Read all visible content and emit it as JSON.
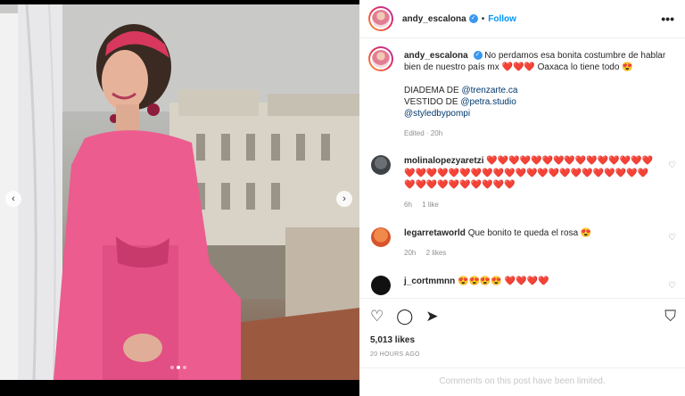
{
  "post": {
    "username": "andy_escalona",
    "follow_label": "Follow",
    "separator": "•",
    "more_glyph": "•••",
    "verified_glyph": "✓"
  },
  "caption": {
    "username": "andy_escalona",
    "text_1": "No perdamos esa bonita costumbre de hablar bien de nuestro país mx",
    "hearts_1": "❤️❤️❤️",
    "text_2": "Oaxaca lo tiene todo",
    "emoji_2": "😍",
    "diadema_label": "DIADEMA DE",
    "diadema_mention": "@trenzarte.ca",
    "vestido_label": "VESTIDO DE",
    "vestido_mention": "@petra.studio",
    "styled_mention": "@styledbypompi",
    "meta": "Edited · 20h"
  },
  "comments": [
    {
      "username": "molinalopezyaretzi",
      "text": "❤️❤️❤️❤️❤️❤️❤️❤️❤️❤️❤️❤️❤️❤️❤️❤️❤️❤️❤️❤️❤️❤️❤️❤️❤️❤️❤️❤️❤️❤️❤️❤️❤️❤️❤️❤️❤️❤️❤️❤️❤️❤️❤️❤️❤️❤️❤️",
      "time": "6h",
      "likes": "1 like"
    },
    {
      "username": "legarretaworld",
      "text": "Que bonito te queda el rosa 😍",
      "time": "20h",
      "likes": "2 likes"
    },
    {
      "username": "j_cortmmnn",
      "text": "😍😍😍😍 ❤️❤️❤️❤️",
      "time": "",
      "likes": ""
    }
  ],
  "actions": {
    "like_icon": "♡",
    "comment_icon": "◯",
    "share_icon": "➤",
    "save_icon": "⛉",
    "likes_count": "5,013 likes",
    "time_ago": "20 HOURS AGO",
    "comments_disabled": "Comments on this post have been limited."
  },
  "media": {
    "prev_glyph": "‹",
    "next_glyph": "›",
    "carousel_dots": 3,
    "active_dot": 1
  },
  "like_glyph": "♡"
}
